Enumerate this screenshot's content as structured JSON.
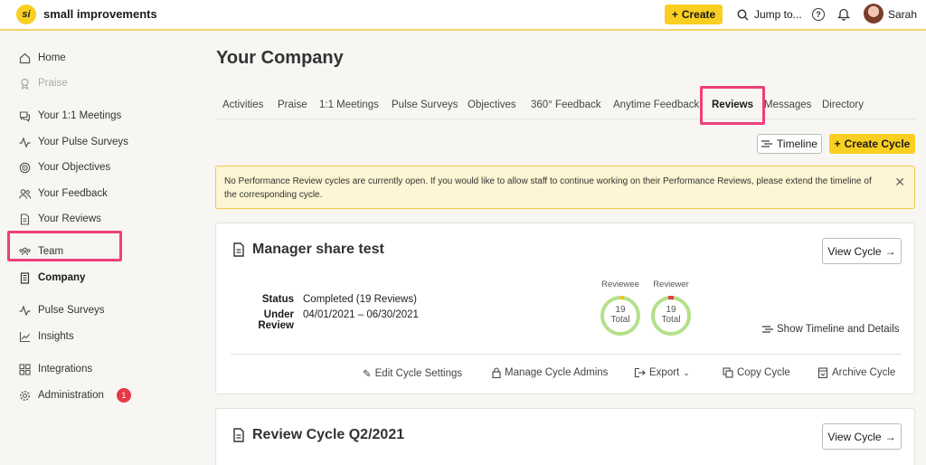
{
  "app": {
    "brand": "small improvements",
    "logo_text": "si"
  },
  "topbar": {
    "create_label": "Create",
    "jump_label": "Jump to...",
    "user_name": "Sarah",
    "colors": {
      "accent": "#f9cf21",
      "accent_line": "#f3d36a"
    }
  },
  "sidebar": {
    "items": [
      {
        "label": "Home",
        "icon": "home-icon"
      },
      {
        "label": "Praise",
        "icon": "award-icon"
      },
      {
        "label": "Your 1:1 Meetings",
        "icon": "chat-icon"
      },
      {
        "label": "Your Pulse Surveys",
        "icon": "pulse-icon"
      },
      {
        "label": "Your Objectives",
        "icon": "target-icon"
      },
      {
        "label": "Your Feedback",
        "icon": "people-icon"
      },
      {
        "label": "Your Reviews",
        "icon": "document-icon"
      },
      {
        "label": "Team",
        "icon": "team-icon"
      },
      {
        "label": "Company",
        "icon": "building-icon"
      },
      {
        "label": "Pulse Surveys",
        "icon": "pulse-icon"
      },
      {
        "label": "Insights",
        "icon": "chart-icon"
      },
      {
        "label": "Integrations",
        "icon": "grid-icon"
      },
      {
        "label": "Administration",
        "icon": "gear-icon"
      }
    ],
    "admin_badge": "1"
  },
  "main": {
    "title": "Your Company",
    "tabs": [
      "Activities",
      "Praise",
      "1:1 Meetings",
      "Pulse Surveys",
      "Objectives",
      "360° Feedback",
      "Anytime Feedback",
      "Reviews",
      "Messages",
      "Directory"
    ],
    "active_tab": "Reviews",
    "timeline_label": "Timeline",
    "create_cycle_label": "Create Cycle",
    "notice": "No Performance Review cycles are currently open. If you would like to allow staff to continue working on their Performance Reviews, please extend the timeline of the corresponding cycle.",
    "close_glyph": "✕",
    "cycles": [
      {
        "title": "Manager share test",
        "view_label": "View Cycle",
        "status_key": "Status",
        "status_val": "Completed (19 Reviews)",
        "review_key": "Under Review",
        "review_val": "04/01/2021 – 06/30/2021",
        "reviewee_label": "Reviewee",
        "reviewee_total": "19",
        "reviewee_total_label": "Total",
        "reviewer_label": "Reviewer",
        "reviewer_total": "19",
        "reviewer_total_label": "Total",
        "show_timeline_label": "Show Timeline and Details",
        "actions": {
          "edit": "Edit Cycle Settings",
          "admins": "Manage Cycle Admins",
          "export": "Export",
          "copy": "Copy Cycle",
          "archive": "Archive Cycle"
        }
      },
      {
        "title": "Review Cycle Q2/2021",
        "view_label": "View Cycle"
      }
    ]
  }
}
